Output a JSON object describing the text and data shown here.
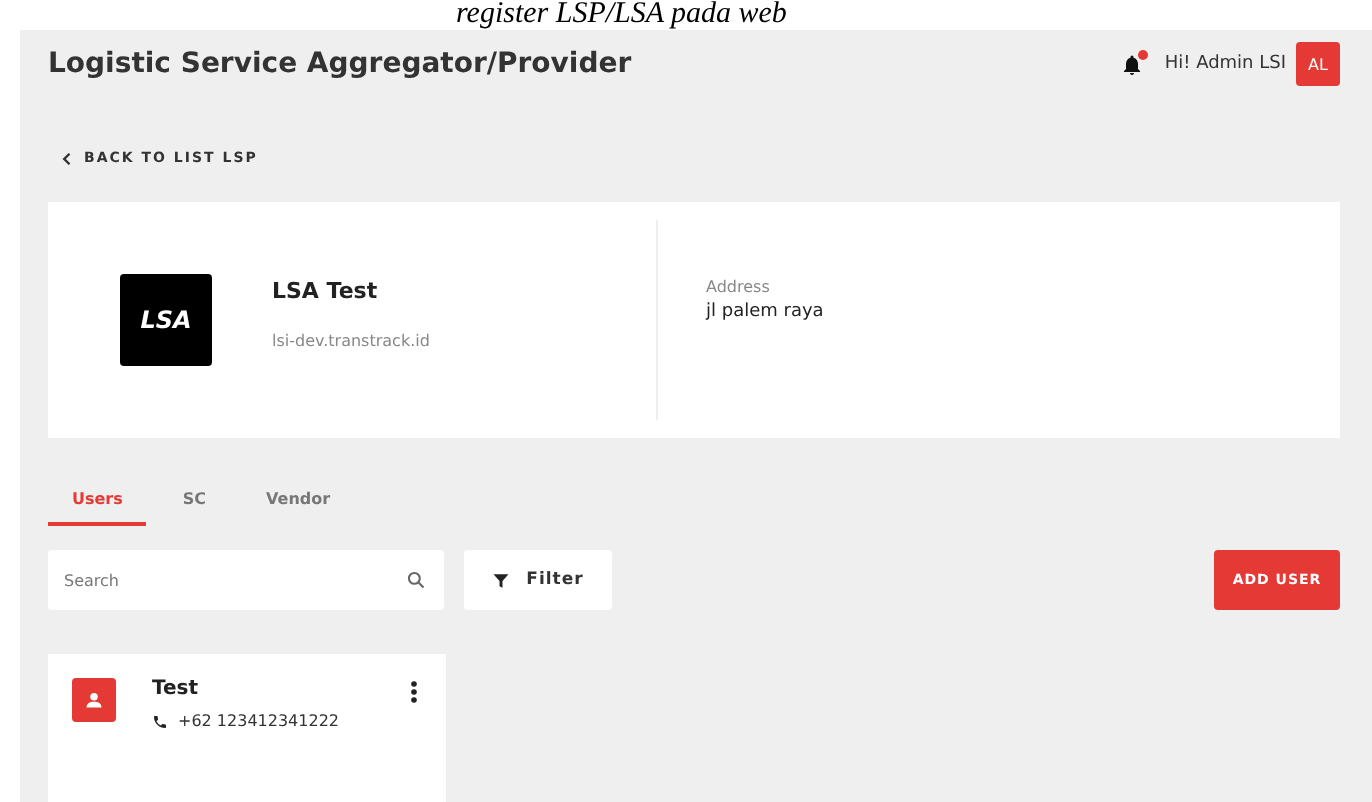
{
  "caption": "register LSP/LSA pada web",
  "header": {
    "title": "Logistic Service Aggregator/Provider",
    "greeting": "Hi! Admin LSI",
    "avatar": "AL",
    "has_notification": true
  },
  "back_link": "BACK TO LIST LSP",
  "company": {
    "logo": "LSA",
    "name": "LSA Test",
    "domain": "lsi-dev.transtrack.id",
    "address_label": "Address",
    "address": "jl palem raya"
  },
  "tabs": [
    {
      "label": "Users",
      "selected": true
    },
    {
      "label": "SC",
      "selected": false
    },
    {
      "label": "Vendor",
      "selected": false
    }
  ],
  "search": {
    "placeholder": "Search"
  },
  "filter_button": "Filter",
  "add_button": "ADD USER",
  "users": [
    {
      "name": "Test",
      "phone": "+62 123412341222"
    }
  ]
}
